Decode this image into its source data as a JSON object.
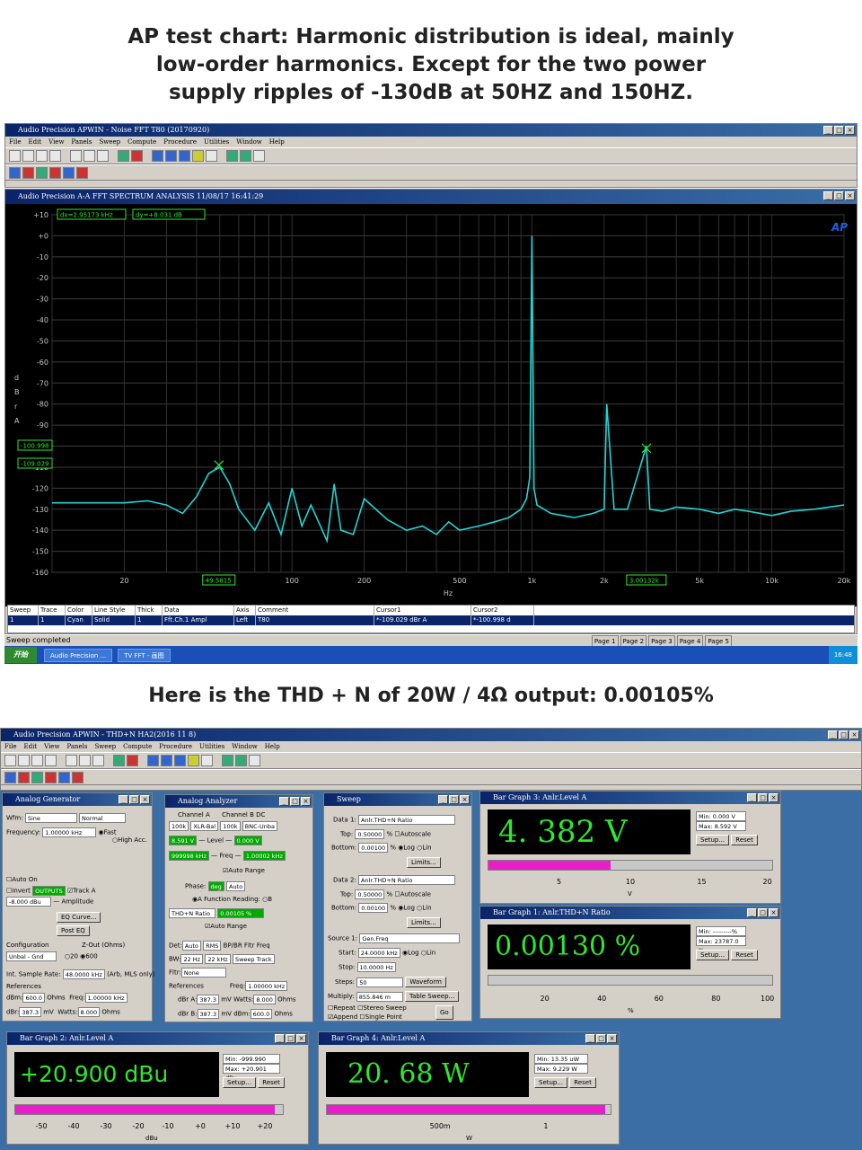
{
  "captions": {
    "top": "AP test chart: Harmonic distribution is ideal, mainly low-order harmonics. Except for the two power supply ripples of -130dB at 50HZ and 150HZ.",
    "middle": "Here is the THD + N of 20W / 4Ω output: 0.00105%"
  },
  "apwin1": {
    "title": "Audio Precision APWIN - Noise FFT T80 (20170920)",
    "menu": [
      "File",
      "Edit",
      "View",
      "Panels",
      "Sweep",
      "Compute",
      "Procedure",
      "Utilities",
      "Window",
      "Help"
    ]
  },
  "fft_window": {
    "title": "Audio Precision    A-A FFT SPECTRUM ANALYSIS    11/08/17 16:41:29",
    "dx_readout": "dx=2.95173 kHz",
    "dy_readout": "dy=+8.031  dB",
    "y_axis_label": [
      "d",
      "B",
      "r",
      "A"
    ],
    "x_axis_label": "Hz",
    "cursor1_box": "-109.029",
    "cursor2_box": "-100.998",
    "cursor1_x": "49.5815",
    "cursor2_x": "3.00132k",
    "ap_logo": "AP"
  },
  "chart_data": {
    "type": "line",
    "xlabel": "Hz",
    "ylabel": "dBrA",
    "xscale": "log",
    "xlim": [
      10,
      20000
    ],
    "ylim": [
      -160,
      10
    ],
    "xticks": [
      "20",
      "50",
      "100",
      "200",
      "500",
      "1k",
      "2k",
      "5k",
      "10k",
      "20k"
    ],
    "yticks": [
      "+10",
      "+0",
      "-10",
      "-20",
      "-30",
      "-40",
      "-50",
      "-60",
      "-70",
      "-80",
      "-90",
      "-100",
      "-110",
      "-120",
      "-130",
      "-140",
      "-150",
      "-160"
    ],
    "grid": true,
    "series": [
      {
        "color": "#1fd6d6",
        "x": [
          10,
          20,
          25,
          30,
          35,
          40,
          45,
          50,
          55,
          60,
          70,
          80,
          90,
          100,
          110,
          120,
          140,
          150,
          160,
          180,
          200,
          250,
          300,
          350,
          400,
          450,
          500,
          600,
          700,
          800,
          900,
          950,
          980,
          1000,
          1020,
          1050,
          1200,
          1500,
          1800,
          2000,
          2050,
          2200,
          2500,
          3000,
          3100,
          3500,
          4000,
          5000,
          6000,
          7000,
          8000,
          10000,
          12000,
          15000,
          20000
        ],
        "y": [
          -127,
          -127,
          -126,
          -128,
          -132,
          -124,
          -113,
          -110,
          -118,
          -130,
          -140,
          -127,
          -142,
          -120,
          -138,
          -128,
          -145,
          -118,
          -140,
          -142,
          -125,
          -135,
          -140,
          -138,
          -142,
          -136,
          -140,
          -138,
          -136,
          -134,
          -130,
          -125,
          -115,
          0,
          -120,
          -128,
          -132,
          -134,
          -132,
          -130,
          -80,
          -130,
          -130,
          -100,
          -130,
          -131,
          -129,
          -130,
          -132,
          -130,
          -131,
          -133,
          -131,
          -130,
          -128
        ]
      }
    ]
  },
  "trace_table": {
    "headers": [
      "Sweep",
      "Trace",
      "Color",
      "Line Style",
      "Thick",
      "Data",
      "Axis",
      "Comment",
      "Cursor1",
      "Cursor2"
    ],
    "row": [
      "1",
      "1",
      "Cyan",
      "Solid",
      "1",
      "Fft.Ch.1 Ampl",
      "Left",
      "T80",
      "*-109.029 dBr A",
      "*-100.998 d"
    ]
  },
  "status": {
    "text": "Sweep completed",
    "pages": [
      "Page 1",
      "Page 2",
      "Page 3",
      "Page 4",
      "Page 5"
    ]
  },
  "taskbar": {
    "start": "开始",
    "items": [
      "Audio Precision ...",
      "TV FFT - 画图"
    ],
    "clock": "16:48"
  },
  "apwin2": {
    "title": "Audio Precision APWIN - THD+N HA2(2016 11 8)",
    "menu": [
      "File",
      "Edit",
      "View",
      "Panels",
      "Sweep",
      "Compute",
      "Procedure",
      "Utilities",
      "Window",
      "Help"
    ]
  },
  "analog_generator": {
    "title": "Analog Generator",
    "wfm_label": "Wfm:",
    "wfm": "Sine",
    "wfm2": "Normal",
    "freq_label": "Frequency:",
    "freq": "1.00000 kHz",
    "fast": "Fast",
    "high_acc": "High Acc.",
    "auto_on": "Auto On",
    "invert": "Invert",
    "outputs": "OUTPUTS",
    "track_a": "Track A",
    "amplitude": "-8.000 dBu",
    "amp_label": "Amplitude",
    "eq_curve": "EQ Curve...",
    "post_eq": "Post EQ",
    "config_label": "Configuration",
    "config": "Unbal - Gnd",
    "zout_label": "Z-Out (Ohms)",
    "zout1": "20",
    "zout2": "600",
    "sample_rate_label": "Int. Sample Rate:",
    "sample_rate": "48.0000 kHz",
    "sample_note": "(Arb, MLS only)",
    "refs_label": "References",
    "dbm_label": "dBm:",
    "dbm": "600.0",
    "ohms": "Ohms",
    "freq_ref_label": "Freq:",
    "freq_ref": "1.00000 kHz",
    "dbr_label": "dBr:",
    "dbr": "387.3",
    "dbr_unit": "mV",
    "watts_label": "Watts:",
    "watts": "8.000",
    "watts_unit": "Ohms"
  },
  "analog_analyzer": {
    "title": "Analog Analyzer",
    "ch_a": "Channel A",
    "ch_b": "Channel B",
    "dc": "DC",
    "ch_a_input": "XLR-Bal",
    "ch_b_input": "BNC-Unba",
    "ohm": "100k",
    "level_a": "8.591 V",
    "level_b": "0.000 V",
    "level_label": "Level",
    "freq_a": "999998 kHz",
    "freq_b": "1.00002 kHz",
    "freq_label": "Freq",
    "auto_range": "Auto Range",
    "phase_label": "Phase:",
    "phase": "deg",
    "phase_mode": "Auto",
    "function_reading": "Function Reading:",
    "func": "THD+N Ratio",
    "func_value": "0.00105 %",
    "det_label": "Det:",
    "det": "Auto",
    "det2": "RMS",
    "bw_label": "BW:",
    "bw": "22 Hz",
    "bw2": "22 kHz",
    "fltr_label": "Fltr:",
    "fltr": "None",
    "bpbr": "BP/BR Fltr Freq",
    "sweep_track": "Sweep Track",
    "refs_label": "References",
    "freq_ref_label": "Freq:",
    "freq_ref": "1.00000 kHz",
    "dbra_label": "dBr A:",
    "dbra": "387.3",
    "dbrb_label": "dBr B:",
    "dbrb": "387.3",
    "mv": "mV",
    "watts_label": "Watts:",
    "watts": "8.000",
    "dbm_label": "dBm:",
    "dbm": "600.0",
    "ohms": "Ohms"
  },
  "sweep": {
    "title": "Sweep",
    "data1_label": "Data 1:",
    "data1": "Anlr.THD+N Ratio",
    "top_label": "Top:",
    "top1": "0.50000",
    "pct": "%",
    "bottom_label": "Bottom:",
    "bottom1": "0.00100",
    "autoscale": "Autoscale",
    "log": "Log",
    "lin": "Lin",
    "data2_label": "Data 2:",
    "data2": "Anlr.THD+N Ratio",
    "limits": "Limits...",
    "source_label": "Source 1:",
    "source": "Gen.Freq",
    "start_label": "Start:",
    "start": "24.0000 kHz",
    "stop_label": "Stop:",
    "stop": "10.0000 Hz",
    "steps_label": "Steps:",
    "steps": "50",
    "multiply_label": "Multiply:",
    "multiply": "855.846 m",
    "waveform": "Waveform",
    "table_sweep": "Table Sweep...",
    "repeat": "Repeat",
    "stereo": "Stereo Sweep",
    "append": "Append",
    "single": "Single Point",
    "go": "Go"
  },
  "bar3": {
    "title": "Bar Graph 3: Anlr.Level A",
    "value": "4. 382 V",
    "min": "Min: 0.000  V",
    "max": "Max: 8.592  V",
    "setup": "Setup...",
    "reset": "Reset",
    "fill_fraction": 0.43,
    "scale": [
      "5",
      "10",
      "15",
      "20"
    ],
    "unit": "V"
  },
  "bar1": {
    "title": "Bar Graph 1: Anlr.THD+N Ratio",
    "value": "0.00130  %",
    "min": "Min: ---------%",
    "max": "Max: 23787.0  %",
    "setup": "Setup...",
    "reset": "Reset",
    "fill_fraction": 0.0,
    "scale": [
      "20",
      "40",
      "60",
      "80",
      "100"
    ],
    "unit": "%"
  },
  "bar2": {
    "title": "Bar Graph 2: Anlr.Level A",
    "value": "+20.900  dBu",
    "min": "Min: -999.990 dBu",
    "max": "Max: +20.901 dBu",
    "setup": "Setup...",
    "reset": "Reset",
    "fill_fraction": 0.97,
    "scale": [
      "-50",
      "-40",
      "-30",
      "-20",
      "-10",
      "+0",
      "+10",
      "+20"
    ],
    "unit": "dBu"
  },
  "bar4": {
    "title": "Bar Graph 4: Anlr.Level A",
    "value": "20. 68  W",
    "min": "Min: 13.35  uW",
    "max": "Max: 9.229    W",
    "setup": "Setup...",
    "reset": "Reset",
    "fill_fraction": 0.98,
    "scale": [
      "500m",
      "1"
    ],
    "unit": "W"
  }
}
